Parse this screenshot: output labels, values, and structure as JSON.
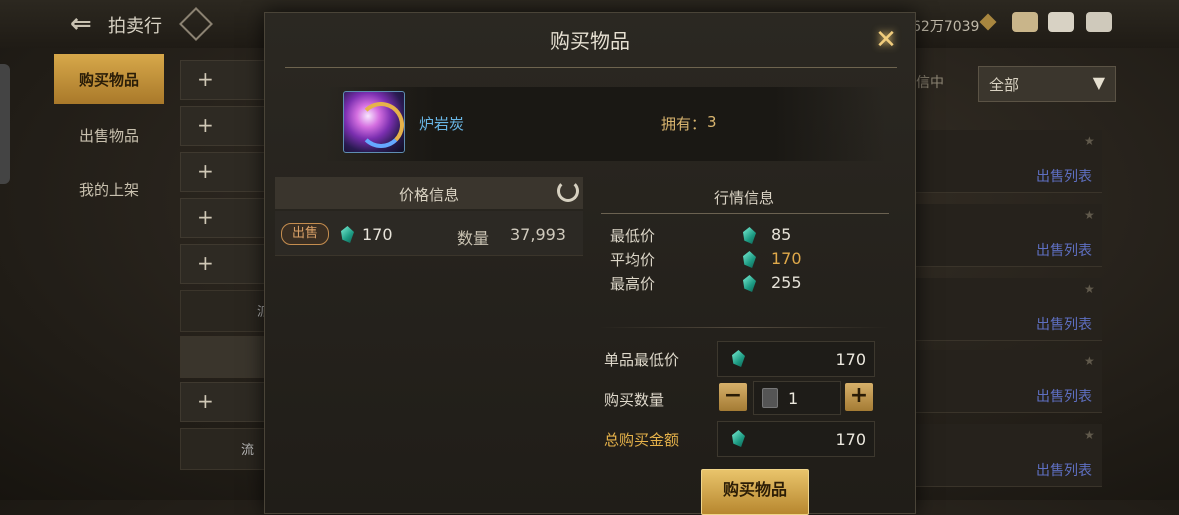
{
  "background": {
    "title": "拍卖行",
    "currency_value": "62万7039",
    "tabs": [
      {
        "label": "购买物品",
        "active": true
      },
      {
        "label": "出售物品",
        "active": false
      },
      {
        "label": "我的上架",
        "active": false
      }
    ],
    "plus_glyph": "+",
    "filter": {
      "label": "全部",
      "arrow": "▼"
    },
    "filter_prefix": "信中",
    "list_link_label": "出售列表",
    "row_labels": [
      "派",
      "流"
    ]
  },
  "modal": {
    "title": "购买物品",
    "close_icon": "close-icon",
    "item": {
      "name": "炉岩炭",
      "owned_label": "拥有：",
      "owned_value": "3"
    },
    "price_info": {
      "header": "价格信息",
      "rows": [
        {
          "badge": "出售",
          "price": "170",
          "qty_label": "数量",
          "qty_value": "37,993"
        }
      ]
    },
    "market": {
      "header": "行情信息",
      "rows": [
        {
          "label": "最低价",
          "value": "85"
        },
        {
          "label": "平均价",
          "value": "170"
        },
        {
          "label": "最高价",
          "value": "255"
        }
      ]
    },
    "form": {
      "unit_price_label": "单品最低价",
      "unit_price_value": "170",
      "qty_label": "购买数量",
      "qty_value": "1",
      "minus": "−",
      "plus": "+",
      "total_label": "总购买金额",
      "total_value": "170"
    },
    "buy_button": "购买物品"
  },
  "colors": {
    "accent_gold": "#e6b24a",
    "item_name": "#69b6e5",
    "link_blue": "#5e6fc1"
  }
}
